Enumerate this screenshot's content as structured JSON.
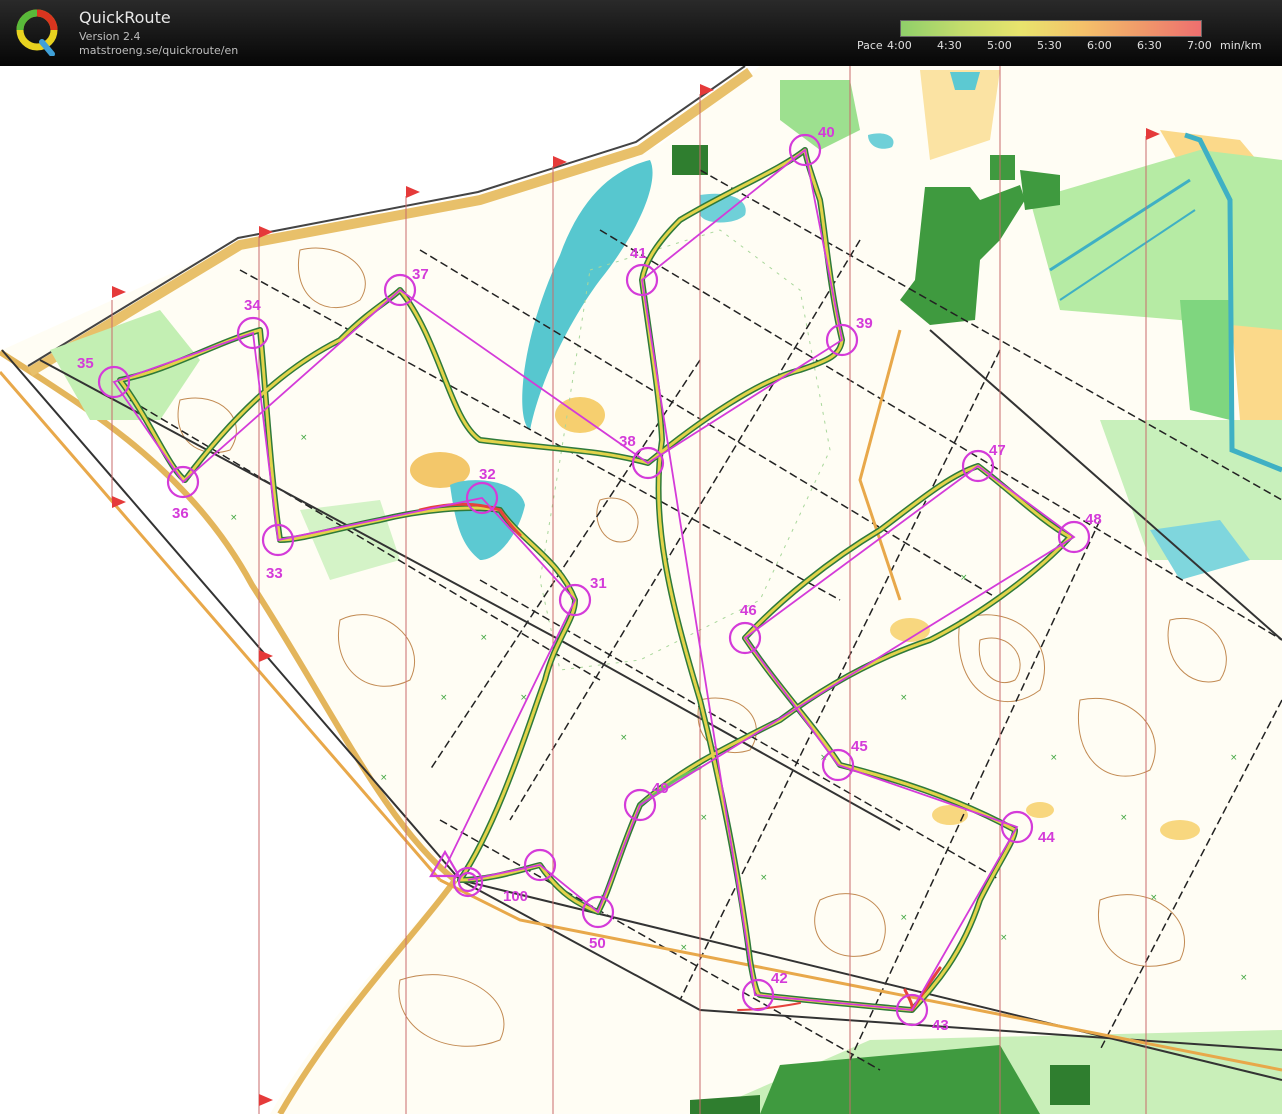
{
  "app": {
    "title": "QuickRoute",
    "version": "Version 2.4",
    "url": "matstroeng.se/quickroute/en"
  },
  "pace_legend": {
    "prefix": "Pace",
    "ticks": [
      "4:00",
      "4:30",
      "5:00",
      "5:30",
      "6:00",
      "6:30",
      "7:00"
    ],
    "unit": "min/km",
    "colors": [
      "#8fcf6a",
      "#c4dc6c",
      "#e9e46d",
      "#f4c26a",
      "#f09a6a",
      "#ee6f6f"
    ]
  },
  "map": {
    "colors": {
      "course": "#d43bd9",
      "route_green": "#4a9a55",
      "route_yellow": "#e4d64a",
      "route_red": "#e5433d",
      "forest_green": "#7fd67f",
      "dark_green": "#2f8a2f",
      "open_yellow": "#f9d98a",
      "water": "#4fc4cf",
      "contour": "#c28a52",
      "magnetic_north": "#c96b6b"
    },
    "controls": [
      {
        "label": "start",
        "symbol": "triangle"
      },
      {
        "label": "31"
      },
      {
        "label": "32"
      },
      {
        "label": "33"
      },
      {
        "label": "34"
      },
      {
        "label": "35"
      },
      {
        "label": "36"
      },
      {
        "label": "37"
      },
      {
        "label": "38"
      },
      {
        "label": "39"
      },
      {
        "label": "40"
      },
      {
        "label": "41"
      },
      {
        "label": "42"
      },
      {
        "label": "43"
      },
      {
        "label": "44"
      },
      {
        "label": "45"
      },
      {
        "label": "46"
      },
      {
        "label": "47"
      },
      {
        "label": "48"
      },
      {
        "label": "49"
      },
      {
        "label": "50"
      },
      {
        "label": "100"
      }
    ]
  }
}
